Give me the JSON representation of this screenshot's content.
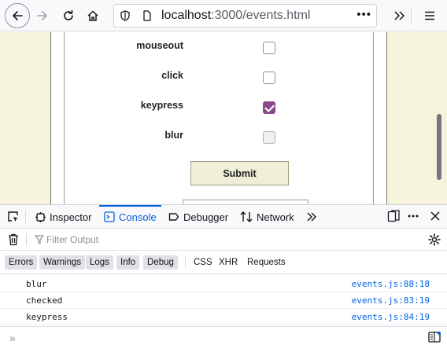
{
  "browser": {
    "url_host": "localhost",
    "url_path": ":3000/events.html",
    "page_actions": "•••"
  },
  "form": {
    "rows": [
      {
        "label": "mouseout",
        "checked": false,
        "disabled": false
      },
      {
        "label": "click",
        "checked": false,
        "disabled": false
      },
      {
        "label": "keypress",
        "checked": true,
        "disabled": false
      },
      {
        "label": "blur",
        "checked": false,
        "disabled": true
      }
    ],
    "submit_label": "Submit",
    "accent_color": "#8a4a8a"
  },
  "devtools": {
    "tabs": [
      {
        "label": "Inspector",
        "icon": "inspector-icon",
        "active": false
      },
      {
        "label": "Console",
        "icon": "console-icon",
        "active": true
      },
      {
        "label": "Debugger",
        "icon": "debugger-icon",
        "active": false
      },
      {
        "label": "Network",
        "icon": "network-icon",
        "active": false
      }
    ],
    "filter_placeholder": "Filter Output",
    "levels": [
      "Errors",
      "Warnings",
      "Logs",
      "Info",
      "Debug"
    ],
    "categories": [
      "CSS",
      "XHR",
      "Requests"
    ],
    "messages": [
      {
        "text": "blur",
        "source": "events.js:88:18"
      },
      {
        "text": "checked",
        "source": "events.js:83:19"
      },
      {
        "text": "keypress",
        "source": "events.js:84:19"
      }
    ]
  }
}
